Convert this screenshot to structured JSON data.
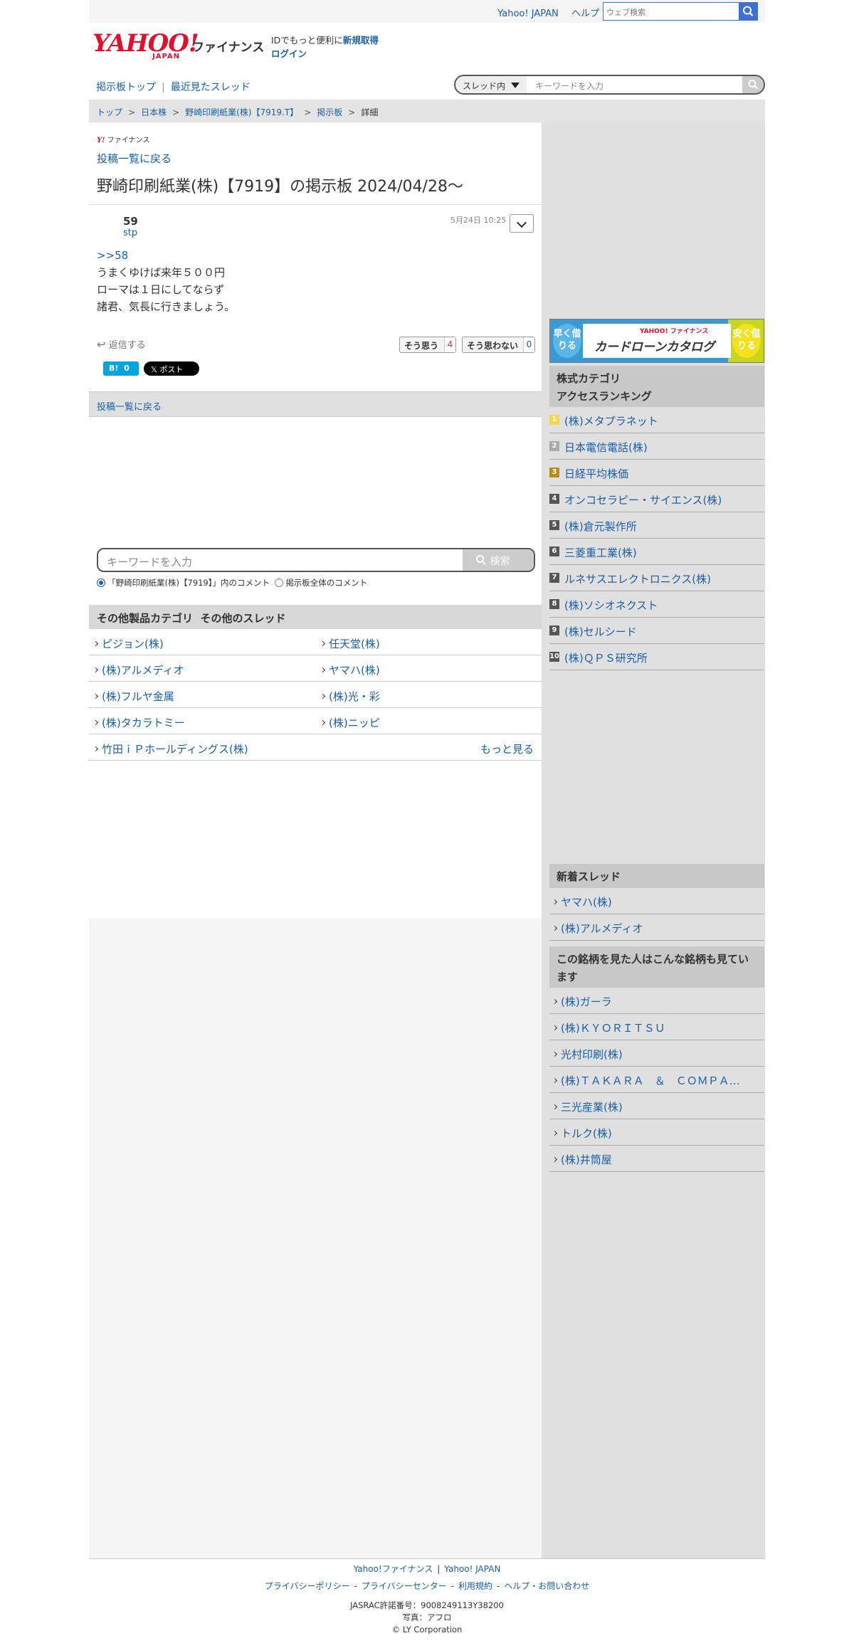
{
  "topbar": {
    "yahoo_japan": "Yahoo! JAPAN",
    "help": "ヘルプ",
    "web_search_placeholder": "ウェブ検索"
  },
  "header": {
    "logo_yahoo": "YAHOO!",
    "logo_japan": "JAPAN",
    "logo_finance": "ファイナンス",
    "id_message": "IDでもっと便利に",
    "register": "新規取得",
    "login": "ログイン"
  },
  "subnav": {
    "board_top": "掲示板トップ",
    "recent_threads": "最近見たスレッド",
    "scope": "スレッド内",
    "keyword_placeholder": "キーワードを入力"
  },
  "breadcrumb": [
    "トップ",
    "日本株",
    "野崎印刷紙業(株)【7919.T】",
    "掲示板",
    "詳細"
  ],
  "main": {
    "small_logo_y": "Y!",
    "small_logo_text": "ファイナンス",
    "back_to_list": "投稿一覧に戻る",
    "board_title": "野崎印刷紙業(株)【7919】の掲示板 2024/04/28〜"
  },
  "post": {
    "number": "59",
    "user": "stp",
    "date": "5月24日 10:25",
    "body": [
      ">>58",
      "うまくゆけば来年５００円",
      "ローマは１日にしてならず",
      "諸君、気長に行きましょう。"
    ],
    "reply_label": "返信する",
    "agree_label": "そう思う",
    "agree_count": "4",
    "disagree_label": "そう思わない",
    "disagree_count": "0",
    "hatena_count": "0",
    "x_post_label": "ポスト"
  },
  "back_bar": "投稿一覧に戻る",
  "keyword_search": {
    "placeholder": "キーワードを入力",
    "button": "検索",
    "radio_in_thread": "「野崎印刷紙業(株)【7919】」内のコメント",
    "radio_all": "掲示板全体のコメント"
  },
  "other_threads": {
    "heading": "その他製品カテゴリ  その他のスレッド",
    "rows": [
      [
        "ピジョン(株)",
        "任天堂(株)"
      ],
      [
        "(株)アルメディオ",
        "ヤマハ(株)"
      ],
      [
        "(株)フルヤ金属",
        "(株)光・彩"
      ],
      [
        "(株)タカラトミー",
        "(株)ニッピ"
      ]
    ],
    "last": "竹田ｉＰホールディングス(株)",
    "more": "もっと見る"
  },
  "sidebar": {
    "ad_top": "YAHOO! ファイナンス",
    "ad_title": "カードローンカタログ",
    "ad_left": "早く借りる",
    "ad_right": "安く借りる",
    "ranking_head1": "株式カテゴリ",
    "ranking_head2": "アクセスランキング",
    "ranking": [
      {
        "rank": "1",
        "name": "(株)メタプラネット"
      },
      {
        "rank": "2",
        "name": "日本電信電話(株)"
      },
      {
        "rank": "3",
        "name": "日経平均株価"
      },
      {
        "rank": "4",
        "name": "オンコセラピー・サイエンス(株)"
      },
      {
        "rank": "5",
        "name": "(株)倉元製作所"
      },
      {
        "rank": "6",
        "name": "三菱重工業(株)"
      },
      {
        "rank": "7",
        "name": "ルネサスエレクトロニクス(株)"
      },
      {
        "rank": "8",
        "name": "(株)ソシオネクスト"
      },
      {
        "rank": "9",
        "name": "(株)セルシード"
      },
      {
        "rank": "10",
        "name": "(株)ＱＰＳ研究所"
      }
    ],
    "new_threads_head": "新着スレッド",
    "new_threads": [
      "ヤマハ(株)",
      "(株)アルメディオ"
    ],
    "also_viewed_head": "この銘柄を見た人はこんな銘柄も見ています",
    "also_viewed": [
      "(株)ガーラ",
      "(株)ＫＹＯＲＩＴＳＵ",
      "光村印刷(株)",
      "(株)ＴＡＫＡＲＡ　＆　ＣＯＭＰＡ…",
      "三光産業(株)",
      "トルク(株)",
      "(株)井筒屋"
    ]
  },
  "footer": {
    "yahoo_finance": "Yahoo!ファイナンス",
    "yahoo_japan": "Yahoo! JAPAN",
    "privacy_policy": "プライバシーポリシー",
    "privacy_center": "プライバシーセンター",
    "terms": "利用規約",
    "help_contact": "ヘルプ・お問い合わせ",
    "jasrac": "JASRAC許諾番号：9008249113Y38200",
    "photo": "写真：アフロ",
    "copyright": "© LY Corporation"
  }
}
